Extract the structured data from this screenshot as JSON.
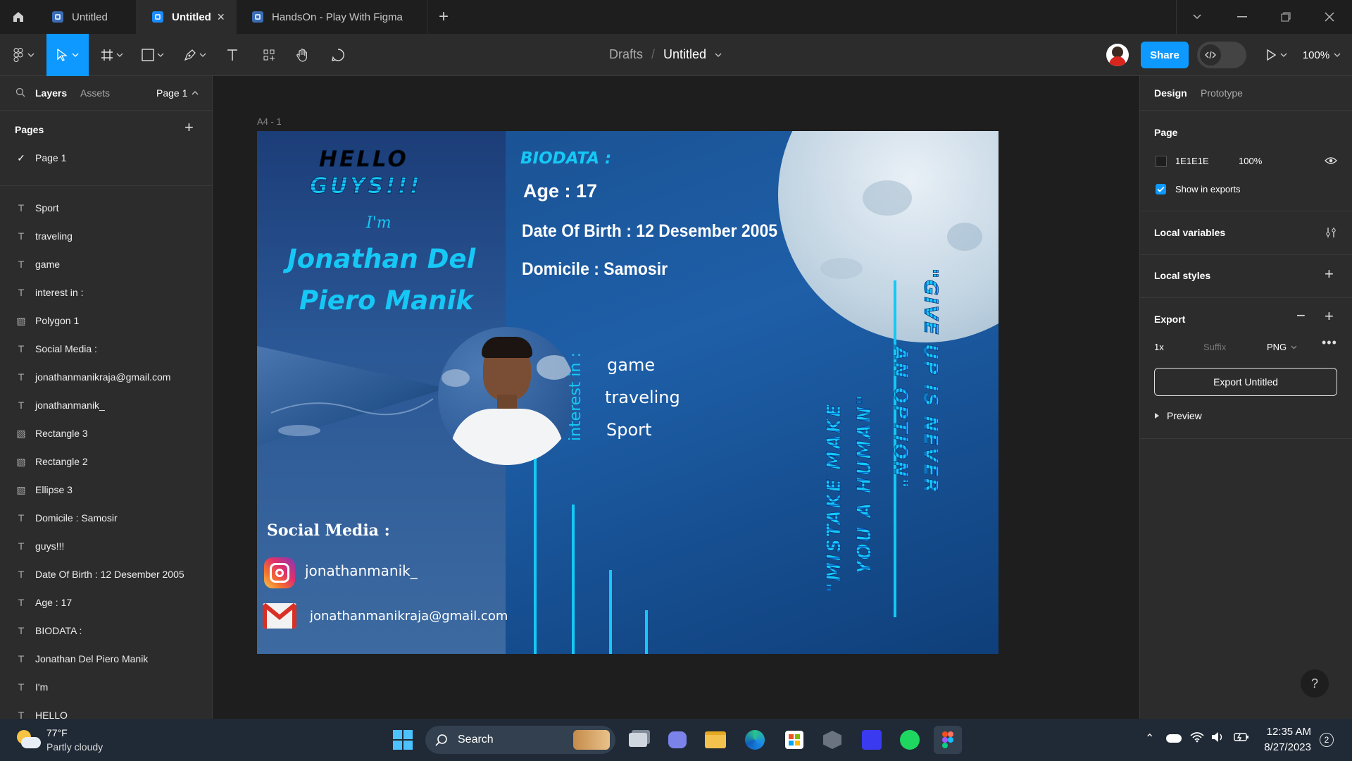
{
  "tabs": [
    {
      "label": "Untitled"
    },
    {
      "label": "Untitled"
    },
    {
      "label": "HandsOn - Play With Figma"
    }
  ],
  "toolbar": {
    "breadcrumb_root": "Drafts",
    "separator": "/",
    "file_name": "Untitled",
    "share_label": "Share",
    "zoom": "100%"
  },
  "left_panel": {
    "tab_layers": "Layers",
    "tab_assets": "Assets",
    "page_selector": "Page 1",
    "pages_title": "Pages",
    "current_page": "Page 1",
    "layers": [
      {
        "name": "Sport",
        "type": "text"
      },
      {
        "name": "traveling",
        "type": "text"
      },
      {
        "name": "game",
        "type": "text"
      },
      {
        "name": "interest in :",
        "type": "text"
      },
      {
        "name": "Polygon 1",
        "type": "image"
      },
      {
        "name": "Social Media :",
        "type": "text"
      },
      {
        "name": "jonathanmanikraja@gmail.com",
        "type": "text"
      },
      {
        "name": "jonathanmanik_",
        "type": "text"
      },
      {
        "name": "Rectangle 3",
        "type": "image"
      },
      {
        "name": "Rectangle 2",
        "type": "image"
      },
      {
        "name": "Ellipse 3",
        "type": "image"
      },
      {
        "name": "Domicile : Samosir",
        "type": "text"
      },
      {
        "name": "guys!!!",
        "type": "text"
      },
      {
        "name": "Date Of Birth : 12 Desember 2005",
        "type": "text"
      },
      {
        "name": "Age : 17",
        "type": "text"
      },
      {
        "name": "BIODATA :",
        "type": "text"
      },
      {
        "name": "Jonathan Del Piero Manik",
        "type": "text"
      },
      {
        "name": "I'm",
        "type": "text"
      },
      {
        "name": "HELLO",
        "type": "text"
      }
    ]
  },
  "canvas": {
    "frame_label": "A4 - 1",
    "card": {
      "hello": "HELLO",
      "guys": "GUYS!!!",
      "im": "I'm",
      "name_line1": "Jonathan Del",
      "name_line2": "Piero Manik",
      "biodata": "BIODATA :",
      "age": "Age : 17",
      "dob": "Date Of Birth : 12 Desember 2005",
      "domicile": "Domicile : Samosir",
      "interest_label": "interest in :",
      "interests": [
        "game",
        "traveling",
        "Sport"
      ],
      "social_title": "Social Media :",
      "instagram": "jonathanmanik_",
      "email": "jonathanmanikraja@gmail.com",
      "quote1_line1": "\"MISTAKE MAKE",
      "quote1_line2": "YOU A HUMAN\"",
      "quote2_line1": "\"GIVE UP IS NEVER",
      "quote2_line2": "AN OPTION\""
    }
  },
  "right_panel": {
    "tab_design": "Design",
    "tab_prototype": "Prototype",
    "page_title": "Page",
    "page_color": "1E1E1E",
    "page_opacity": "100%",
    "show_in_exports": "Show in exports",
    "local_variables": "Local variables",
    "local_styles": "Local styles",
    "export_title": "Export",
    "export_scale": "1x",
    "export_suffix_placeholder": "Suffix",
    "export_format": "PNG",
    "export_button": "Export Untitled",
    "preview": "Preview"
  },
  "taskbar": {
    "weather_temp": "77°F",
    "weather_desc": "Partly cloudy",
    "search_label": "Search",
    "time": "12:35 AM",
    "date": "8/27/2023",
    "notification_count": "2"
  },
  "colors": {
    "accent": "#0d99ff",
    "panel_bg": "#2c2c2c",
    "canvas_bg": "#1e1e1e",
    "card_cyan": "#16c8f5"
  }
}
